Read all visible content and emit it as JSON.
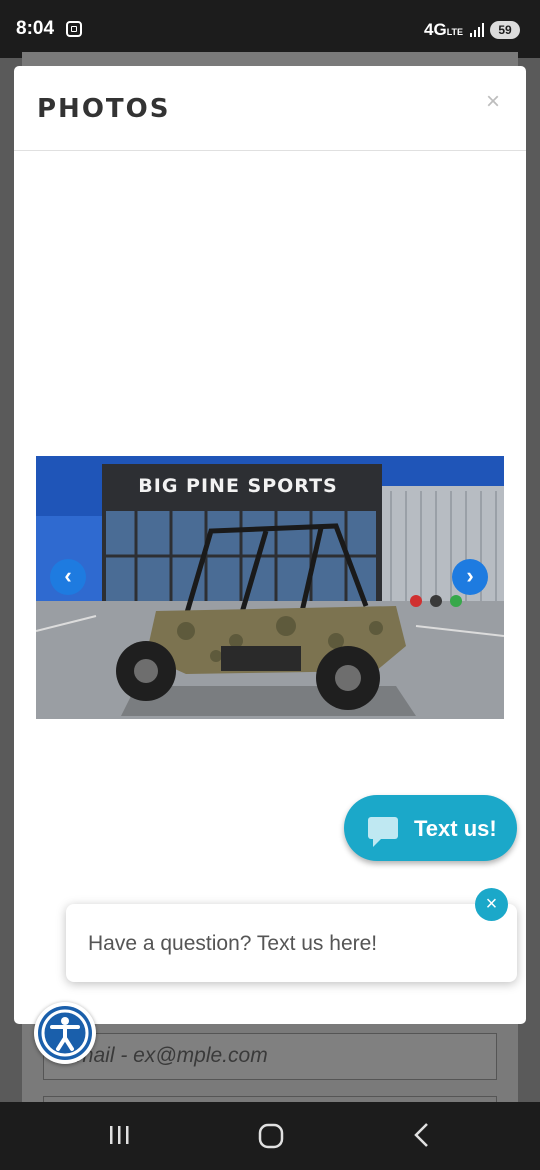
{
  "status_bar": {
    "time": "8:04",
    "network": "4G",
    "network_sub": "LTE",
    "battery": "59"
  },
  "modal": {
    "title": "PHOTOS",
    "close": "×",
    "image_alt": "BIG PINE SPORTS",
    "prev_icon": "‹",
    "next_icon": "›"
  },
  "chat": {
    "text_us_label": "Text us!",
    "question": "Have a question? Text us here!",
    "close": "×"
  },
  "background_form": {
    "email_placeholder": "Email - ex@mple.com"
  },
  "colors": {
    "accent": "#1ba8c9",
    "nav_blue": "#1e7be0",
    "a11y_blue": "#1a5fab"
  },
  "icons": [
    "screen-record-icon",
    "signal-icon",
    "chat-bubble-icon",
    "accessibility-icon",
    "recent-apps-icon",
    "home-icon",
    "back-icon"
  ]
}
